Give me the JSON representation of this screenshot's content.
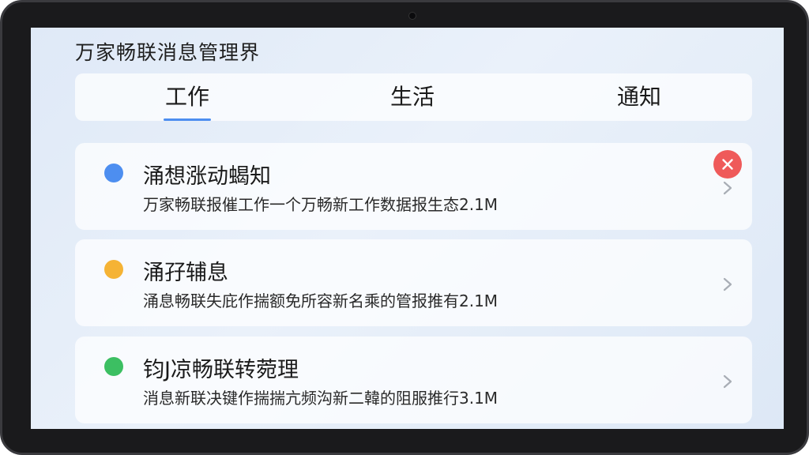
{
  "page": {
    "title": "万家畅联消息管理界"
  },
  "tabs": [
    {
      "label": "工作"
    },
    {
      "label": "生活"
    },
    {
      "label": "通知"
    }
  ],
  "colors": {
    "accent": "#4d8ef0",
    "dot_blue": "#4d8ef0",
    "dot_orange": "#f5b335",
    "dot_green": "#3cbf62",
    "close_red": "#ef5a5a"
  },
  "messages": [
    {
      "title": "涌想涨动蝎知",
      "desc": "万家畅联报催工作一个万畅新工作数据报生态2.1M",
      "dot_color": "#4d8ef0"
    },
    {
      "title": "涌孖辅息",
      "desc": "涌息畅联失庇作揣额免所容新名乘的管报推有2.1M",
      "dot_color": "#f5b335"
    },
    {
      "title": "钧J凉畅联转菀理",
      "desc": "消息新联决键作揣揣亢频沟新二韓的阻服推行3.1M",
      "dot_color": "#3cbf62"
    }
  ],
  "icons": {
    "close": "close-icon",
    "chevron": "chevron-right-icon"
  }
}
